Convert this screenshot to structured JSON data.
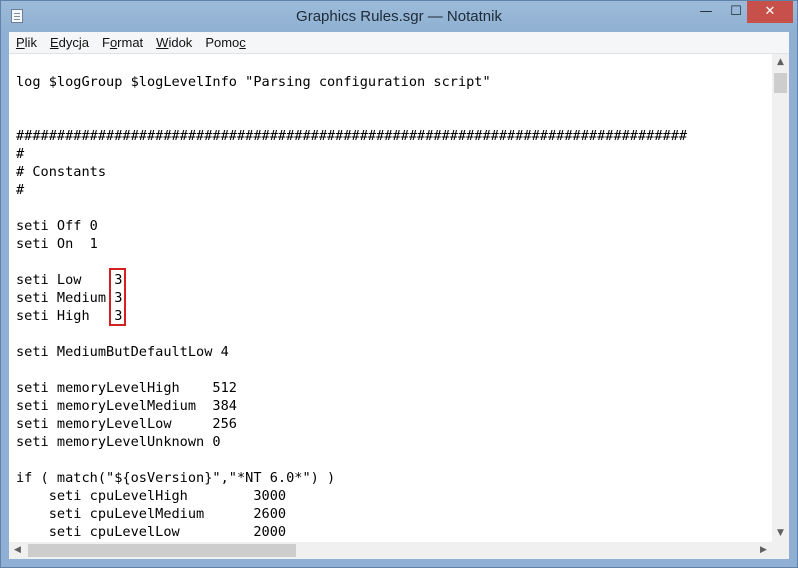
{
  "window": {
    "title": "Graphics Rules.sgr — Notatnik",
    "minimize_glyph": "—",
    "maximize_glyph": "☐",
    "close_glyph": "✕"
  },
  "menu": {
    "items": [
      {
        "accel": "P",
        "rest": "lik"
      },
      {
        "accel": "E",
        "rest": "dycja"
      },
      {
        "pre": "F",
        "accel": "o",
        "rest": "rmat"
      },
      {
        "accel": "W",
        "rest": "idok"
      },
      {
        "pre": "Pomo",
        "accel": "c",
        "rest": ""
      }
    ]
  },
  "document": {
    "lines": [
      "",
      "log $logGroup $logLevelInfo \"Parsing configuration script\"",
      "",
      "",
      "##################################################################################",
      "#",
      "# Constants",
      "#",
      "",
      "seti Off 0",
      "seti On  1",
      "",
      "seti Low    3",
      "seti Medium 3",
      "seti High   3",
      "",
      "seti MediumButDefaultLow 4",
      "",
      "seti memoryLevelHigh    512",
      "seti memoryLevelMedium  384",
      "seti memoryLevelLow     256",
      "seti memoryLevelUnknown 0",
      "",
      "if ( match(\"${osVersion}\",\"*NT 6.0*\") )",
      "    seti cpuLevelHigh        3000",
      "    seti cpuLevelMedium      2600",
      "    seti cpuLevelLow         2000"
    ]
  },
  "scrollbars": {
    "up_glyph": "▲",
    "down_glyph": "▼",
    "left_glyph": "◀",
    "right_glyph": "▶"
  },
  "colors": {
    "highlight_border": "#d42020",
    "titlebar": "#8fb0d2",
    "close_button": "#c7504b"
  }
}
